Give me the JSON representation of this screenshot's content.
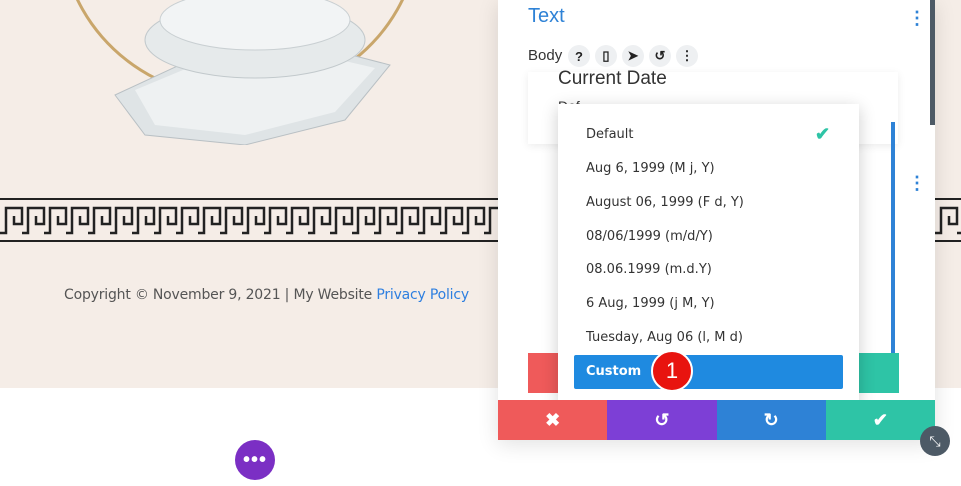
{
  "footer": {
    "copyright_text": "Copyright © November 9, 2021 | My Website ",
    "privacy_link": "Privacy Policy"
  },
  "fab": {
    "label": "•••"
  },
  "panel": {
    "title": "Text",
    "body_label": "Body",
    "tools": [
      "?",
      "▯",
      "➤",
      "↺",
      "⋮"
    ],
    "date_card": {
      "title": "Current Date",
      "sub": "Def"
    }
  },
  "dropdown": {
    "items": [
      "Default",
      "Aug 6, 1999 (M j, Y)",
      "August 06, 1999 (F d, Y)",
      "08/06/1999 (m/d/Y)",
      "08.06.1999 (m.d.Y)",
      "6 Aug, 1999 (j M, Y)",
      "Tuesday, Aug 06 (l, M d)"
    ],
    "selected_check": "✔",
    "custom_label": "Custom"
  },
  "step_badge": "1",
  "action_bar": {
    "cancel": "✖",
    "undo": "↺",
    "redo": "↻",
    "save": "✔"
  },
  "colors": {
    "accent": "#2e82d6",
    "cancel": "#ef5a5a",
    "undo": "#7d3fd6",
    "save": "#2ec4a6",
    "fab": "#7b2fc4"
  }
}
